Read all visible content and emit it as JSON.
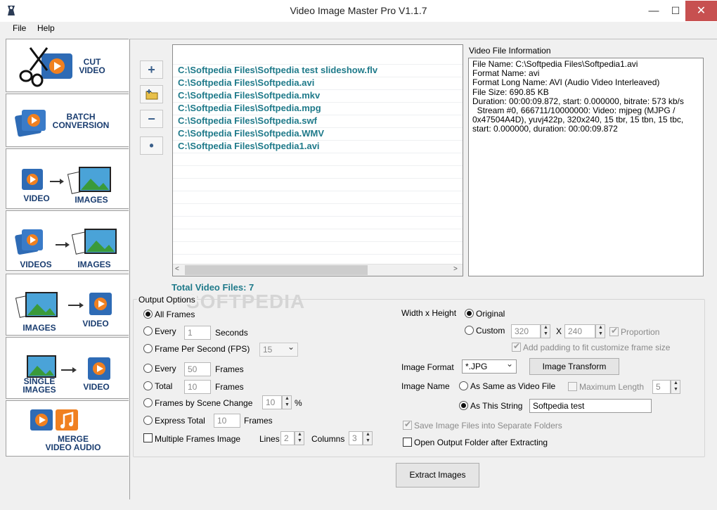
{
  "window": {
    "title": "Video Image Master Pro V1.1.7"
  },
  "menu": [
    "File",
    "Help"
  ],
  "sidebar": [
    {
      "line1": "CUT",
      "line2": "VIDEO"
    },
    {
      "line1": "BATCH",
      "line2": "CONVERSION"
    },
    {
      "left": "VIDEO",
      "right": "IMAGES"
    },
    {
      "left": "VIDEOS",
      "right": "IMAGES"
    },
    {
      "left": "IMAGES",
      "right": "VIDEO"
    },
    {
      "left1": "SINGLE",
      "left2": "IMAGES",
      "right": "VIDEO"
    },
    {
      "line1": "MERGE",
      "line2": "VIDEO AUDIO"
    }
  ],
  "toolbar": {
    "add": "+",
    "remove": "−",
    "dot": "•"
  },
  "files": [
    "C:\\Softpedia Files\\Softpedia test slideshow.flv",
    "C:\\Softpedia Files\\Softpedia.avi",
    "C:\\Softpedia Files\\Softpedia.mkv",
    "C:\\Softpedia Files\\Softpedia.mpg",
    "C:\\Softpedia Files\\Softpedia.swf",
    "C:\\Softpedia Files\\Softpedia.WMV",
    "C:\\Softpedia Files\\Softpedia1.avi"
  ],
  "info": {
    "title": "Video File Information",
    "text": "File Name: C:\\Softpedia Files\\Softpedia1.avi\nFormat Name: avi\nFormat Long Name: AVI (Audio Video Interleaved)\nFile Size: 690.85 KB\nDuration: 00:00:09.872, start: 0.000000, bitrate: 573 kb/s\n  Stream #0, 666711/10000000: Video: mjpeg (MJPG / 0x47504A4D), yuvj422p, 320x240, 15 tbr, 15 tbn, 15 tbc, start: 0.000000, duration: 00:00:09.872"
  },
  "total": "Total Video Files: 7",
  "watermark": "SOFTPEDIA",
  "options": {
    "title": "Output Options",
    "all_frames": "All Frames",
    "every": "Every",
    "every_seconds_value": "1",
    "seconds": "Seconds",
    "fps_label": "Frame Per Second (FPS)",
    "fps_value": "15",
    "every2": "Every",
    "every_frames_value": "50",
    "frames": "Frames",
    "total": "Total",
    "total_value": "10",
    "scene_label": "Frames by Scene Change",
    "scene_value": "10",
    "percent": "%",
    "express_label": "Express Total",
    "express_value": "10",
    "multi_label": "Multiple Frames Image",
    "lines_label": "Lines",
    "lines_value": "2",
    "columns_label": "Columns",
    "columns_value": "3",
    "wh_label": "Width x Height",
    "original": "Original",
    "custom": "Custom",
    "width_value": "320",
    "x_sep": "X",
    "height_value": "240",
    "proportion": "Proportion",
    "padding": "Add padding to fit customize frame size",
    "format_label": "Image Format",
    "format_value": "*.JPG",
    "transform_btn": "Image Transform",
    "name_label": "Image Name",
    "same_as_video": "As Same as Video File",
    "max_length": "Maximum Length",
    "max_length_value": "5",
    "as_string": "As This String",
    "string_value": "Softpedia test",
    "save_separate": "Save Image Files into Separate Folders",
    "open_output": "Open Output Folder after Extracting"
  },
  "extract_btn": "Extract Images",
  "colors": {
    "accent_text": "#1f7a8a",
    "sidebar_text": "#1a3d70",
    "close_btn": "#c75050"
  }
}
